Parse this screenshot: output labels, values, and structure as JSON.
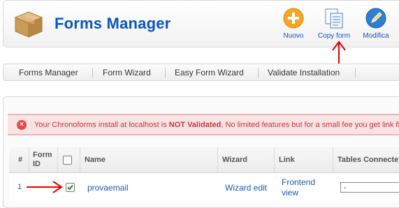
{
  "header": {
    "title": "Forms Manager",
    "logo_icon": "cardboard-box-icon",
    "toolbar": [
      {
        "label": "Nuovo",
        "icon": "add-icon",
        "color": "#f5a623"
      },
      {
        "label": "Copy form",
        "icon": "copy-documents-icon",
        "color": "#4a7fc8"
      },
      {
        "label": "Modifica",
        "icon": "edit-pencil-icon",
        "color": "#2e7fd1"
      }
    ]
  },
  "submenu": {
    "items": [
      "Forms Manager",
      "Form Wizard",
      "Easy Form Wizard",
      "Validate Installation"
    ]
  },
  "alert": {
    "prefix": "Your Chronoforms install at localhost is ",
    "emphasis": "NOT Validated",
    "suffix": ", No limited features but for a small fee you get link fr"
  },
  "table": {
    "headers": {
      "num": "#",
      "form_id": "Form ID",
      "name": "Name",
      "wizard": "Wizard",
      "link": "Link",
      "tables": "Tables Connecte"
    },
    "rows": [
      {
        "num": "1",
        "checked": true,
        "name": "provaemail",
        "wizard": "Wizard edit",
        "link": "Frontend view",
        "tables_value": "-"
      }
    ]
  },
  "colors": {
    "title": "#0b55c4",
    "link": "#1a5ca8",
    "alert_text": "#c0383d",
    "annotation": "#e00000"
  }
}
